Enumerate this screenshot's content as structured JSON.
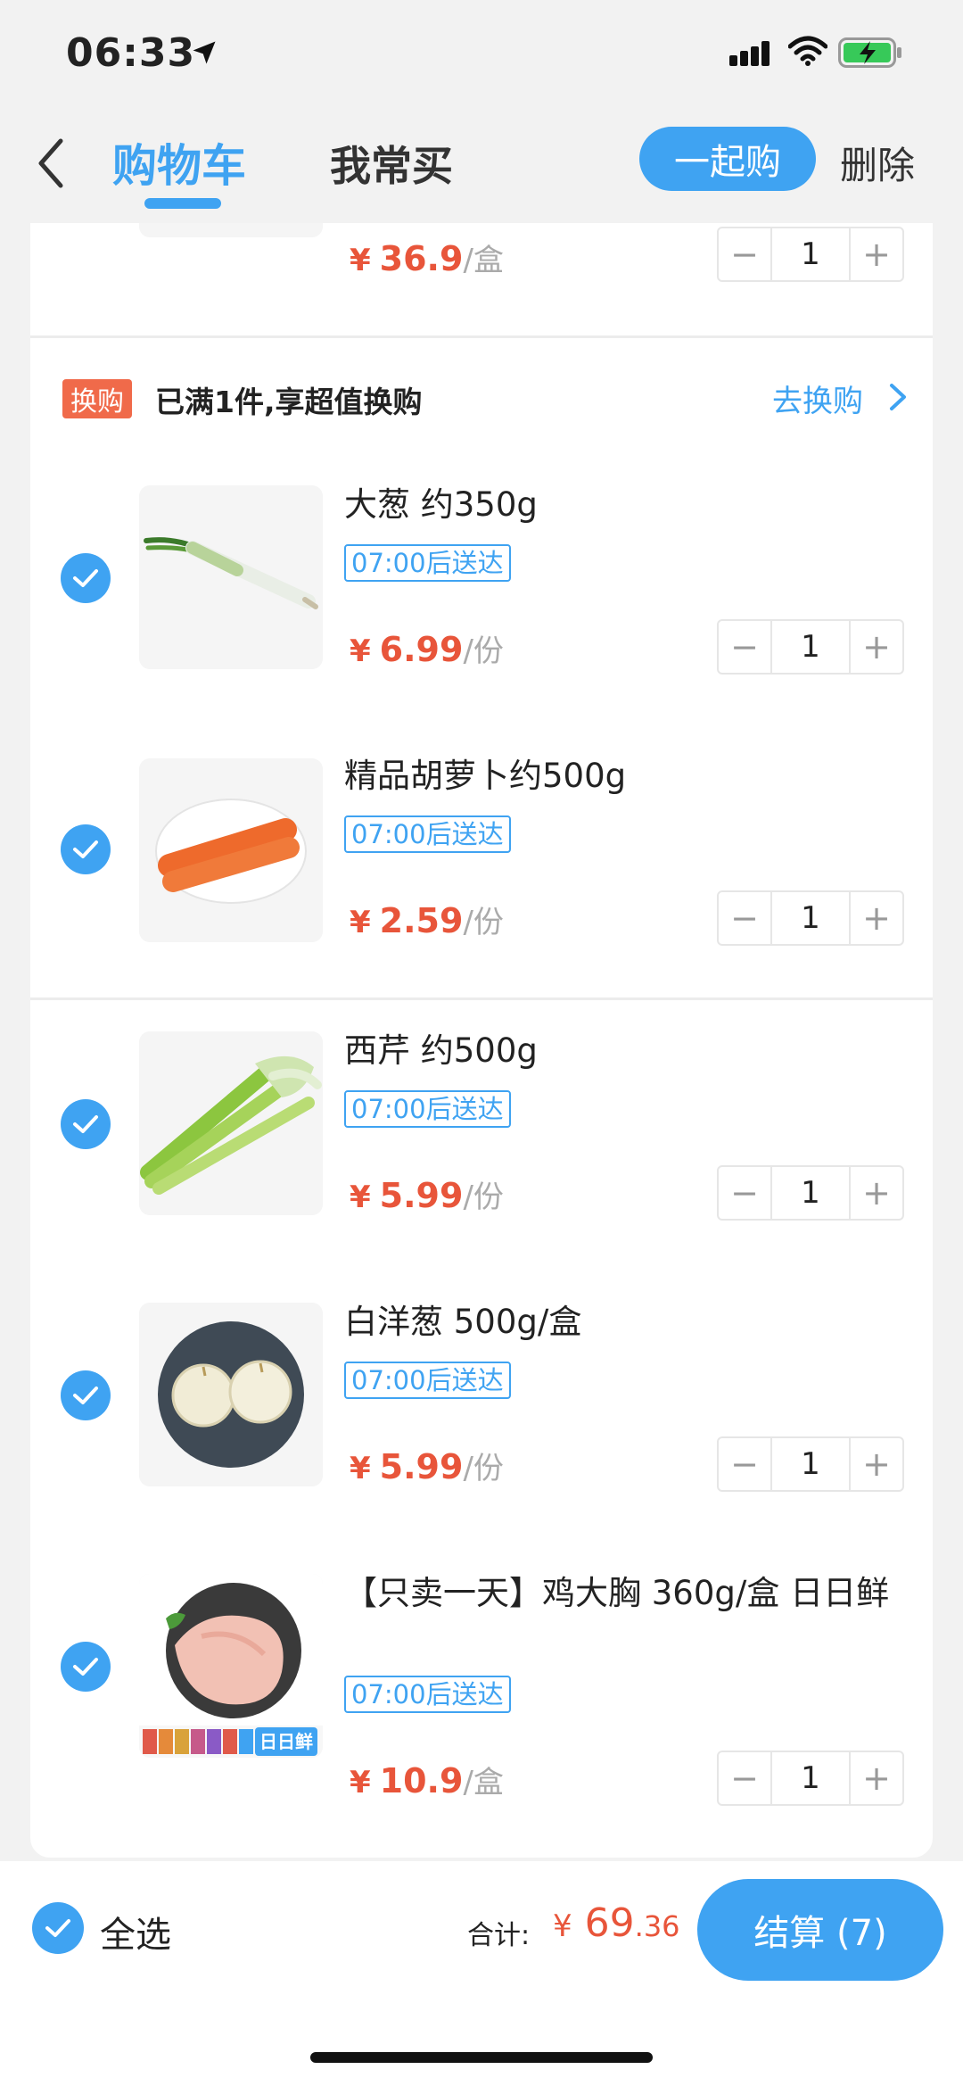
{
  "status_bar": {
    "time": "06:33"
  },
  "header": {
    "tab_cart": "购物车",
    "tab_often": "我常买",
    "together_button": "一起购",
    "delete_button": "删除"
  },
  "top_item": {
    "price": "36.9",
    "unit": "/盒",
    "qty": "1"
  },
  "promo": {
    "tag": "换购",
    "text": "已满1件,享超值换购",
    "link": "去换购"
  },
  "currency": "¥",
  "items": [
    {
      "name": "大葱 约350g",
      "badge": "07:00后送达",
      "price": "6.99",
      "unit": "/份",
      "qty": "1"
    },
    {
      "name": "精品胡萝卜约500g",
      "badge": "07:00后送达",
      "price": "2.59",
      "unit": "/份",
      "qty": "1"
    },
    {
      "name": "西芹 约500g",
      "badge": "07:00后送达",
      "price": "5.99",
      "unit": "/份",
      "qty": "1"
    },
    {
      "name": "白洋葱 500g/盒",
      "badge": "07:00后送达",
      "price": "5.99",
      "unit": "/份",
      "qty": "1"
    },
    {
      "name": "【只卖一天】鸡大胸 360g/盒 日日鲜",
      "badge": "07:00后送达",
      "price": "10.9",
      "unit": "/盒",
      "qty": "1",
      "thumb_brand": "日日鲜"
    }
  ],
  "stepper": {
    "minus": "−",
    "plus": "+"
  },
  "bottom_bar": {
    "select_all": "全选",
    "total_label": "合计:",
    "total_int": "69",
    "total_dec": ".36",
    "checkout_label": "结算 (7)"
  },
  "colors": {
    "accent": "#3fa3f2",
    "price": "#e8553a",
    "promo_tag": "#f06a4a"
  }
}
